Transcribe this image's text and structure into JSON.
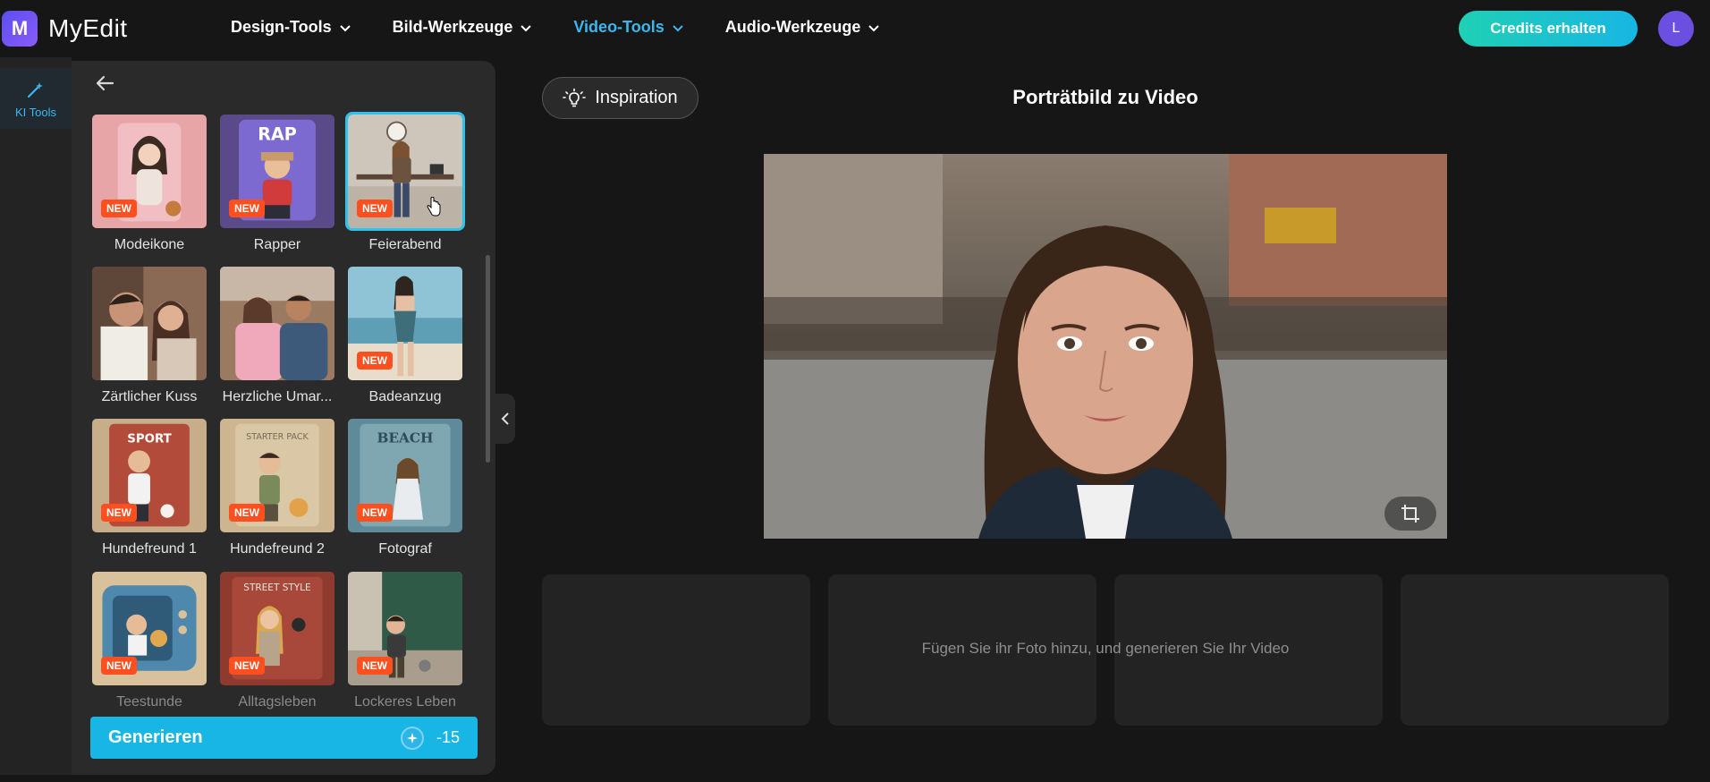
{
  "app": {
    "logo_letter": "M",
    "name": "MyEdit"
  },
  "nav": [
    {
      "label": "Design-Tools",
      "active": false
    },
    {
      "label": "Bild-Werkzeuge",
      "active": false
    },
    {
      "label": "Video-Tools",
      "active": true
    },
    {
      "label": "Audio-Werkzeuge",
      "active": false
    }
  ],
  "header": {
    "credits_label": "Credits erhalten",
    "avatar_initial": "L"
  },
  "rail": {
    "ki_tools_label": "KI Tools"
  },
  "templates": [
    {
      "label": "Modeikone",
      "badge": "NEW"
    },
    {
      "label": "Rapper",
      "badge": "NEW"
    },
    {
      "label": "Feierabend",
      "badge": "NEW",
      "selected": true
    },
    {
      "label": "Zärtlicher Kuss",
      "badge": ""
    },
    {
      "label": "Herzliche Umar...",
      "badge": ""
    },
    {
      "label": "Badeanzug",
      "badge": "NEW"
    },
    {
      "label": "Hundefreund 1",
      "badge": "NEW"
    },
    {
      "label": "Hundefreund 2",
      "badge": "NEW"
    },
    {
      "label": "Fotograf",
      "badge": "NEW"
    },
    {
      "label": "Teestunde",
      "badge": "NEW"
    },
    {
      "label": "Alltagsleben",
      "badge": "NEW"
    },
    {
      "label": "Lockeres Leben",
      "badge": "NEW"
    }
  ],
  "generate": {
    "label": "Generieren",
    "cost": "-15"
  },
  "main": {
    "inspiration_label": "Inspiration",
    "title": "Porträtbild zu Video",
    "hint": "Fügen Sie ihr Foto hinzu, und generieren Sie Ihr Video"
  },
  "colors": {
    "accent": "#18b6e4",
    "badge": "#ff4f1f",
    "active_nav": "#3bb7f0"
  }
}
